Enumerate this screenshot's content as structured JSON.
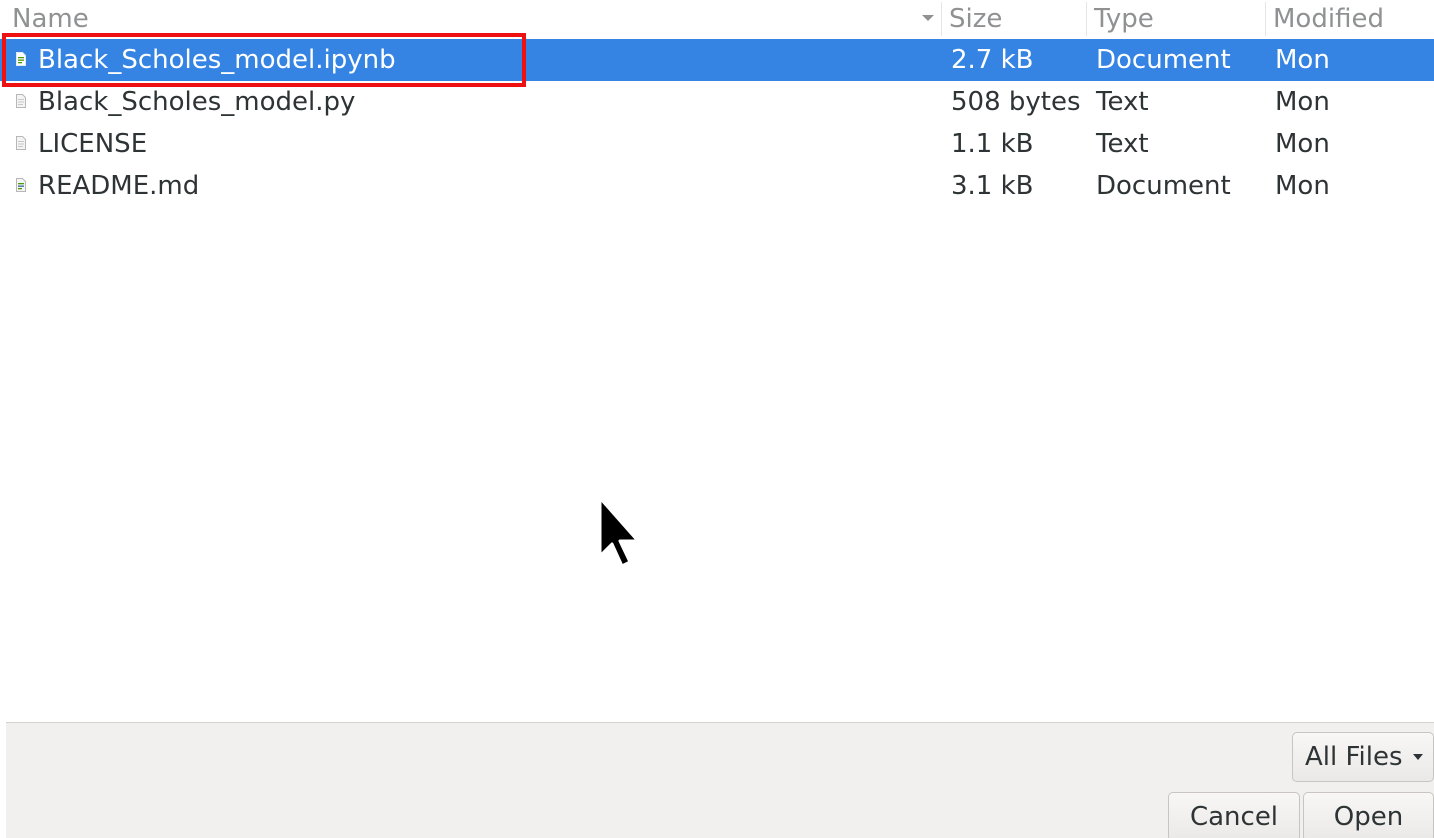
{
  "columns": {
    "name": "Name",
    "size": "Size",
    "type": "Type",
    "modified": "Modified"
  },
  "files": [
    {
      "name": "Black_Scholes_model.ipynb",
      "size": "2.7 kB",
      "type": "Document",
      "modified": "Mon",
      "icon": "document-icon",
      "selected": true
    },
    {
      "name": "Black_Scholes_model.py",
      "size": "508 bytes",
      "type": "Text",
      "modified": "Mon",
      "icon": "text-file-icon",
      "selected": false
    },
    {
      "name": "LICENSE",
      "size": "1.1 kB",
      "type": "Text",
      "modified": "Mon",
      "icon": "text-file-icon",
      "selected": false
    },
    {
      "name": "README.md",
      "size": "3.1 kB",
      "type": "Document",
      "modified": "Mon",
      "icon": "document-icon",
      "selected": false
    }
  ],
  "footer": {
    "filter_label": "All Files",
    "cancel_label": "Cancel",
    "open_label": "Open"
  },
  "colors": {
    "selection": "#3584e4",
    "highlight_box": "#ee1111"
  }
}
